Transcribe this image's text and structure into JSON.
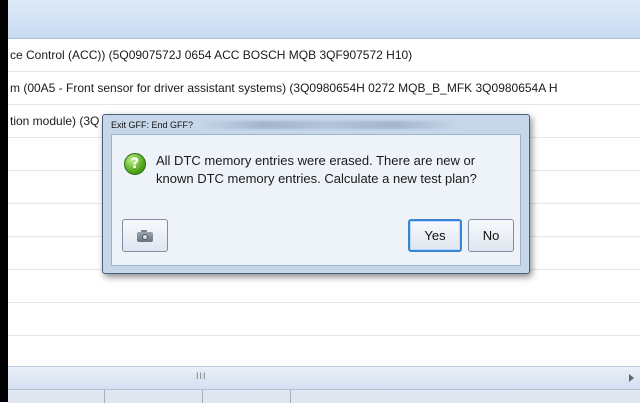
{
  "list": {
    "rows": [
      "ce Control (ACC)) (5Q0907572J   0654   ACC BOSCH MQB   3QF907572     H10)",
      "m (00A5 - Front sensor for driver assistant systems) (3Q0980654H   0272   MQB_B_MFK       3Q0980654A   H",
      "tion module) (3Q",
      "",
      "",
      "",
      "",
      "",
      "",
      ""
    ]
  },
  "scrollbar": {
    "grip_label": "III"
  },
  "dialog": {
    "title": "Exit GFF: End GFF?",
    "icon": "question-icon",
    "message": "All DTC memory entries were erased. There are new or known DTC memory entries. Calculate a new test plan?",
    "camera_icon": "camera-icon",
    "yes_label": "Yes",
    "no_label": "No"
  },
  "colors": {
    "dialog_bg": "#c6d7ea",
    "dialog_inner_bg": "#eef3fa",
    "default_button_border": "#3a84d6",
    "question_icon_green": "#52a81c"
  }
}
